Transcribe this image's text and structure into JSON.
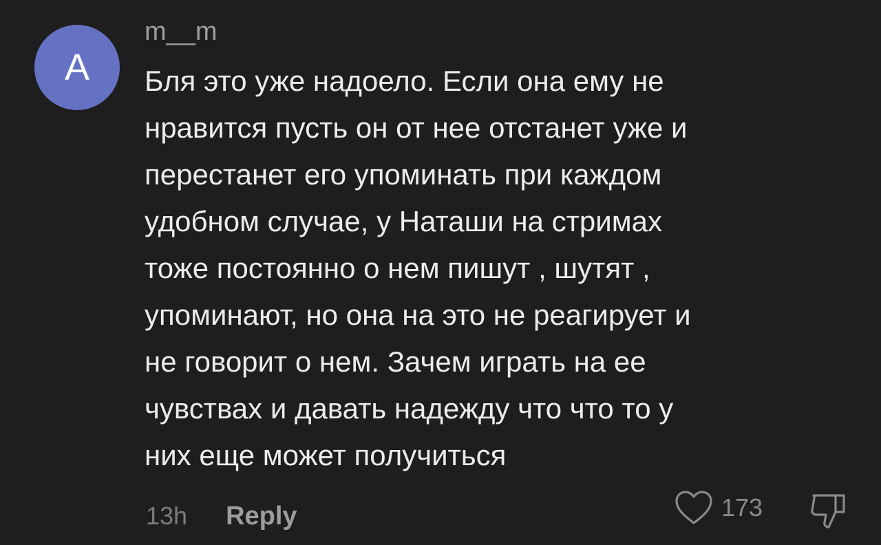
{
  "comment": {
    "avatar_letter": "A",
    "avatar_color": "#6572c4",
    "username": "m__m",
    "text": "Бля это уже надоело. Если она ему не\nнравится пусть он от нее отстанет уже и\nперестанет его упоминать при каждом\nудобном случае, у Наташи на стримах\nтоже постоянно о нем пишут , шутят ,\nупоминают, но она на это не реагирует и\nне говорит о нем. Зачем играть на ее\nчувствах и давать надежду что что то у\nних еще может получиться",
    "timestamp": "13h",
    "reply_label": "Reply",
    "like_count": "173",
    "icons": {
      "like": "heart-icon",
      "dislike": "thumbs-down-icon"
    }
  },
  "colors": {
    "background": "#1e1e1e",
    "text": "#ececec",
    "muted": "#9d9d9d"
  }
}
